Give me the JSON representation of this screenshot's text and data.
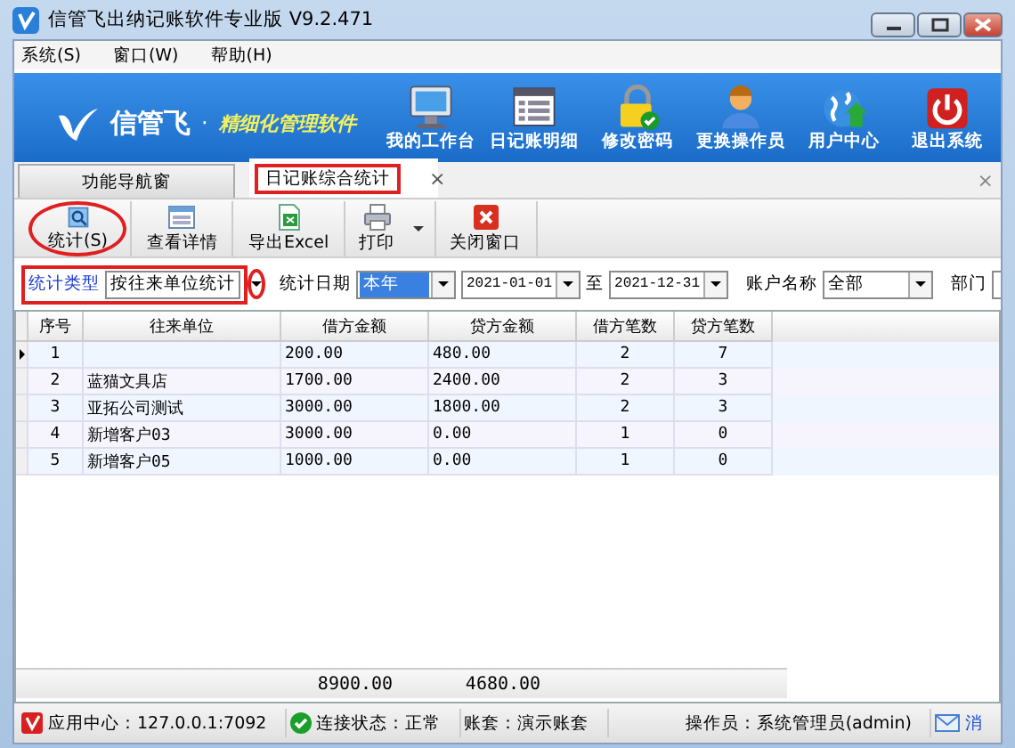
{
  "window": {
    "title": "信管飞出纳记账软件专业版 V9.2.471"
  },
  "menu": [
    {
      "label": "系统(S)"
    },
    {
      "label": "窗口(W)"
    },
    {
      "label": "帮助(H)"
    }
  ],
  "banner": {
    "brand": "信管飞",
    "separator": "·",
    "slogan": "精细化管理软件",
    "items": [
      {
        "label": "我的工作台",
        "kind": "monitor"
      },
      {
        "label": "日记账明细",
        "kind": "list"
      },
      {
        "label": "修改密码",
        "kind": "lock"
      },
      {
        "label": "更换操作员",
        "kind": "user"
      },
      {
        "label": "用户中心",
        "kind": "globe"
      },
      {
        "label": "退出系统",
        "kind": "power"
      }
    ]
  },
  "tabs": [
    {
      "label": "功能导航窗",
      "selected": false,
      "highlighted": false
    },
    {
      "label": "日记账综合统计",
      "selected": true,
      "highlighted": true,
      "close": "×"
    }
  ],
  "tabs_close": "×",
  "toolbar": [
    {
      "label": "统计(S)",
      "kind": "search",
      "highlighted": true,
      "dropdown": false
    },
    {
      "label": "查看详情",
      "kind": "detail",
      "highlighted": false,
      "dropdown": false
    },
    {
      "label": "导出Excel",
      "kind": "excel",
      "highlighted": false,
      "dropdown": false
    },
    {
      "label": "打印",
      "kind": "print",
      "highlighted": false,
      "dropdown": true
    },
    {
      "label": "关闭窗口",
      "kind": "close",
      "highlighted": false,
      "dropdown": false
    }
  ],
  "filters": {
    "stat_type": {
      "label": "统计类型",
      "value": "按往来单位统计",
      "highlighted": true,
      "arrow_highlighted": true
    },
    "date": {
      "label": "统计日期",
      "value": "本年",
      "selected": true
    },
    "from": {
      "value": "2021-01-01"
    },
    "to_label": "至",
    "to": {
      "value": "2021-12-31"
    },
    "account": {
      "label": "账户名称",
      "value": "全部"
    },
    "department": {
      "label": "部门"
    }
  },
  "table": {
    "columns": [
      "序号",
      "往来单位",
      "借方金额",
      "贷方金额",
      "借方笔数",
      "贷方笔数"
    ],
    "rows": [
      {
        "no": "1",
        "debit": "200.00",
        "credit": "480.00",
        "debit_count": "2",
        "credit_count": "7",
        "selected": true
      },
      {
        "no": "2",
        "party": "蓝猫文具店",
        "debit": "1700.00",
        "credit": "2400.00",
        "debit_count": "2",
        "credit_count": "3",
        "selected": false
      },
      {
        "no": "3",
        "party": "亚拓公司测试",
        "debit": "3000.00",
        "credit": "1800.00",
        "debit_count": "2",
        "credit_count": "3",
        "selected": false
      },
      {
        "no": "4",
        "party": "新增客户03",
        "debit": "3000.00",
        "credit": "0.00",
        "debit_count": "1",
        "credit_count": "0",
        "selected": false
      },
      {
        "no": "5",
        "party": "新增客户05",
        "debit": "1000.00",
        "credit": "0.00",
        "debit_count": "1",
        "credit_count": "0",
        "selected": false
      }
    ],
    "totals": {
      "debit": "8900.00",
      "credit": "4680.00"
    }
  },
  "status_bar": [
    {
      "kind": "app",
      "text": "应用中心：127.0.0.1:7092"
    },
    {
      "kind": "ok",
      "text": "连接状态：正常"
    },
    {
      "kind": "plain",
      "text": "账套：演示账套"
    },
    {
      "kind": "plain",
      "text": "操作员：系统管理员(admin)"
    },
    {
      "kind": "mail",
      "text": "消"
    }
  ]
}
